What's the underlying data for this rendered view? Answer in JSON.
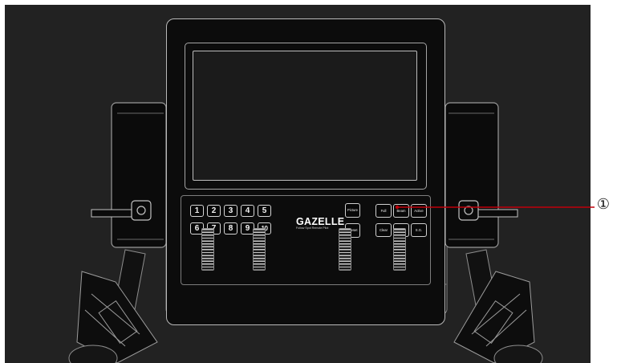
{
  "device": {
    "brand_name": "GAZELLE",
    "brand_tagline": "Follow Spot Remote Pilot",
    "number_keys": [
      "1",
      "2",
      "3",
      "4",
      "5",
      "6",
      "7",
      "8",
      "9",
      "10"
    ],
    "mode_buttons": [
      "Picture",
      "Preset"
    ],
    "function_buttons": [
      "Full",
      "Beam",
      "Active",
      "Clear",
      "D+",
      "S.G."
    ]
  },
  "annotation": {
    "callout_number": "①",
    "callout_color": "#c0000a"
  },
  "colors": {
    "background": "#222222",
    "device_outline": "#b9b9b9",
    "button_fill": "#080808"
  }
}
